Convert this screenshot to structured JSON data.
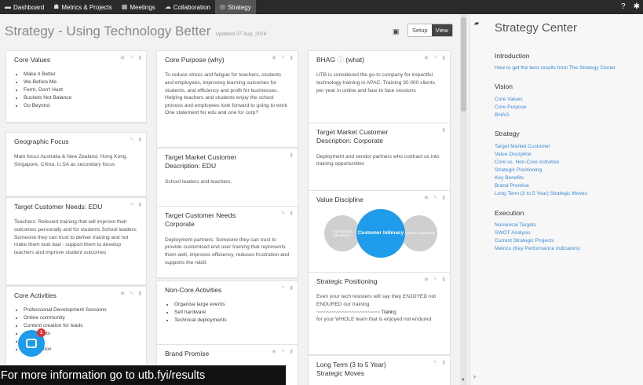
{
  "nav": {
    "items": [
      {
        "icon": "▬",
        "label": "Dashboard"
      },
      {
        "icon": "☗",
        "label": "Metrics & Projects"
      },
      {
        "icon": "▦",
        "label": "Meetings"
      },
      {
        "icon": "☁",
        "label": "Collaboration"
      },
      {
        "icon": "◎",
        "label": "Strategy"
      }
    ],
    "help_icon": "?",
    "settings_icon": "✱"
  },
  "page": {
    "title": "Strategy - Using Technology Better",
    "updated": "Updated 27 Aug, 2018",
    "print_icon": "▣",
    "setup_label": "Setup",
    "view_label": "View"
  },
  "card_icons": {
    "eye": "◉",
    "edit": "✎",
    "delete": "▮"
  },
  "cards": {
    "core_values": {
      "title": "Core Values",
      "items": [
        "Make it Better",
        "We Before Me",
        "Ferm, Don't Hunt",
        "Buckets Not Balance",
        "Go Beyond"
      ]
    },
    "geographic_focus": {
      "title": "Geographic Focus",
      "body": "Main focus Australia & New Zealand. Hong Kong, Singapore, China, U.SA as secondary focus"
    },
    "target_needs_edu": {
      "title": "Target Customer Needs: EDU",
      "body": "Teachers: Relevant training that will improve their outcomes personally and for students School leaders: Someone they can trust to deliver training and not make them look bad - support them to develop teachers and improve student outcomes"
    },
    "core_activities": {
      "title": "Core Activities",
      "items": [
        "Professional Development Sessions",
        "Online community",
        "Content creation for leads",
        "... at events",
        "...g",
        "...ganisation"
      ]
    },
    "core_purpose": {
      "title": "Core Purpose (why)",
      "body": "To reduce stress and fatigue for teachers, students and employees, improving learning outcomes for students, and efficiency and profit for businesses. Helping teachers and students enjoy the school process and employees look forward to going to work One statement for edu and one for corp?"
    },
    "target_desc_edu": {
      "title": "Target Market Customer Description: EDU",
      "body": "School leaders and teachers."
    },
    "target_needs_corp": {
      "title": "Target Customer Needs: Corporate",
      "body": "Deployment partners: Someone they can trust to provide customised end user training that represents them well, improves efficiency, reduces frustration and supports the rebill."
    },
    "non_core": {
      "title": "Non-Core Activities",
      "items": [
        "Organise large events",
        "Sell hardware",
        "Technical deployments"
      ]
    },
    "brand_promise": {
      "title": "Brand Promise"
    },
    "bhag": {
      "title": "BHAG",
      "title_suffix": "(what)",
      "info_icon": "ⓘ",
      "body": "UTB is considered the go-to company for impactful technology training in APAC. Training 30 000 clients per year in online and face to face sessions"
    },
    "target_desc_corp": {
      "title": "Target Market Customer Description: Corporate",
      "body": "Deployment and vendor partners who contract us into training opportunities"
    },
    "value_discipline": {
      "title": "Value Discipline",
      "left": "Operational Excellence",
      "center": "Customer Intimacy",
      "right": "Product Leadership"
    },
    "strategic_positioning": {
      "title": "Strategic Positioning",
      "body1": "Even your tech resisters will say they ENJOYED not ENDURED our training",
      "body2": "~~~~~~~~~~~~~~~~~~~~~~~~~ Training",
      "body3": "for your WHOLE team that is enjoyed not endured"
    },
    "long_term": {
      "title": "Long Term (3 to 5 Year) Strategic Moves"
    }
  },
  "side": {
    "pin_icon": "▰",
    "collapse_icon": "›",
    "title": "Strategy Center",
    "introduction": {
      "heading": "Introduction",
      "links": [
        "How to get the best results from The Strategy Center"
      ]
    },
    "vision": {
      "heading": "Vision",
      "links": [
        "Core Values",
        "Core Purpose",
        "BHAG"
      ]
    },
    "strategy": {
      "heading": "Strategy",
      "links": [
        "Target Market Customer",
        "Value Discipline",
        "Core vs. Non-Core Activities",
        "Strategic Positioning",
        "Key Benefits",
        "Brand Promise",
        "Long Term (3 to 5 Year) Strategic Moves"
      ]
    },
    "execution": {
      "heading": "Execution",
      "links": [
        "Numerical Targets",
        "SWOT Analysis",
        "Current Strategic Projects",
        "Metrics (Key Performance Indicators)"
      ]
    }
  },
  "chat": {
    "badge": "1"
  },
  "banner": {
    "text": "For more information go to utb.fyi/results"
  },
  "colors": {
    "accent": "#1e9bea",
    "link": "#3a8ad6",
    "nav": "#2a2a2a"
  }
}
